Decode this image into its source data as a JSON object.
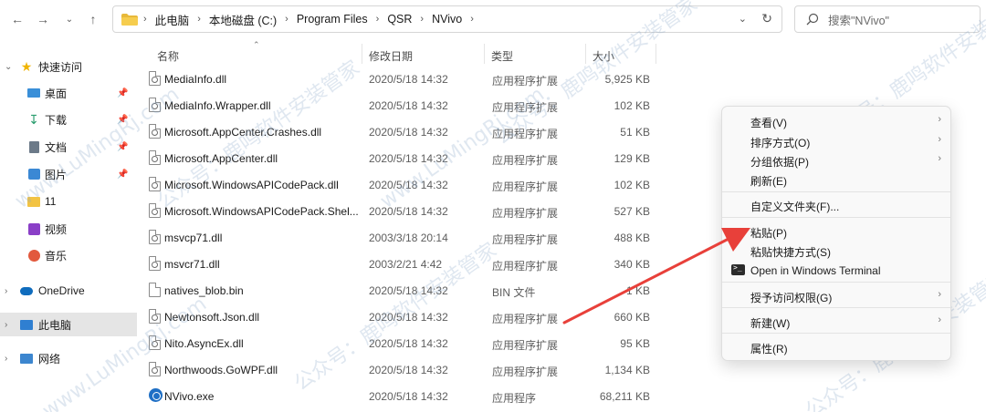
{
  "addressbar": {
    "crumbs": [
      "此电脑",
      "本地磁盘 (C:)",
      "Program Files",
      "QSR",
      "NVivo"
    ]
  },
  "search": {
    "placeholder": "搜索\"NVivo\""
  },
  "sidebar": {
    "items": [
      {
        "label": "快速访问",
        "icon": "star-icon"
      },
      {
        "label": "桌面",
        "icon": "desktop-icon"
      },
      {
        "label": "下载",
        "icon": "download-icon"
      },
      {
        "label": "文档",
        "icon": "document-icon"
      },
      {
        "label": "图片",
        "icon": "pictures-icon"
      },
      {
        "label": "11",
        "icon": "folder-icon"
      },
      {
        "label": "视频",
        "icon": "video-icon"
      },
      {
        "label": "音乐",
        "icon": "music-icon"
      },
      {
        "label": "OneDrive",
        "icon": "cloud-icon"
      },
      {
        "label": "此电脑",
        "icon": "computer-icon"
      },
      {
        "label": "网络",
        "icon": "network-icon"
      }
    ]
  },
  "columns": {
    "name": "名称",
    "date": "修改日期",
    "type": "类型",
    "size": "大小"
  },
  "files": [
    {
      "name": "MediaInfo.dll",
      "date": "2020/5/18 14:32",
      "type": "应用程序扩展",
      "size": "5,925 KB"
    },
    {
      "name": "MediaInfo.Wrapper.dll",
      "date": "2020/5/18 14:32",
      "type": "应用程序扩展",
      "size": "102 KB"
    },
    {
      "name": "Microsoft.AppCenter.Crashes.dll",
      "date": "2020/5/18 14:32",
      "type": "应用程序扩展",
      "size": "51 KB"
    },
    {
      "name": "Microsoft.AppCenter.dll",
      "date": "2020/5/18 14:32",
      "type": "应用程序扩展",
      "size": "129 KB"
    },
    {
      "name": "Microsoft.WindowsAPICodePack.dll",
      "date": "2020/5/18 14:32",
      "type": "应用程序扩展",
      "size": "102 KB"
    },
    {
      "name": "Microsoft.WindowsAPICodePack.Shel...",
      "date": "2020/5/18 14:32",
      "type": "应用程序扩展",
      "size": "527 KB"
    },
    {
      "name": "msvcp71.dll",
      "date": "2003/3/18 20:14",
      "type": "应用程序扩展",
      "size": "488 KB"
    },
    {
      "name": "msvcr71.dll",
      "date": "2003/2/21 4:42",
      "type": "应用程序扩展",
      "size": "340 KB"
    },
    {
      "name": "natives_blob.bin",
      "date": "2020/5/18 14:32",
      "type": "BIN 文件",
      "size": "1 KB"
    },
    {
      "name": "Newtonsoft.Json.dll",
      "date": "2020/5/18 14:32",
      "type": "应用程序扩展",
      "size": "660 KB"
    },
    {
      "name": "Nito.AsyncEx.dll",
      "date": "2020/5/18 14:32",
      "type": "应用程序扩展",
      "size": "95 KB"
    },
    {
      "name": "Northwoods.GoWPF.dll",
      "date": "2020/5/18 14:32",
      "type": "应用程序扩展",
      "size": "1,134 KB"
    },
    {
      "name": "NVivo.exe",
      "date": "2020/5/18 14:32",
      "type": "应用程序",
      "size": "68,211 KB"
    }
  ],
  "context_menu": {
    "view": "查看(V)",
    "sort": "排序方式(O)",
    "group": "分组依据(P)",
    "refresh": "刷新(E)",
    "customize": "自定义文件夹(F)...",
    "paste": "粘贴(P)",
    "paste_shortcut": "粘贴快捷方式(S)",
    "terminal": "Open in Windows Terminal",
    "access": "授予访问权限(G)",
    "new": "新建(W)",
    "properties": "属性(R)"
  },
  "watermark": {
    "text1": "公众号：鹿鸣软件安装管家",
    "text2": "www.LuMingRj.com"
  },
  "colors": {
    "selected_bg": "#e5e5e5",
    "arrow": "#e8403a",
    "accent": "#0067c0"
  }
}
